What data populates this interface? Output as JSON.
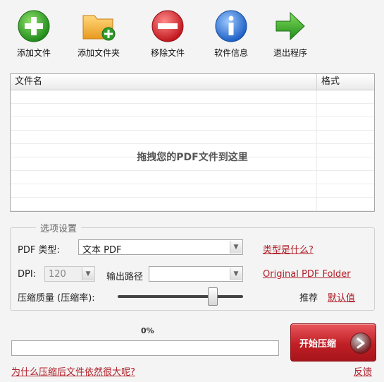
{
  "toolbar": {
    "add_file": "添加文件",
    "add_folder": "添加文件夹",
    "remove_file": "移除文件",
    "about": "软件信息",
    "exit": "退出程序"
  },
  "file_list": {
    "col_name": "文件名",
    "col_format": "格式",
    "drop_hint": "拖拽您的PDF文件到这里"
  },
  "options": {
    "title": "选项设置",
    "pdf_type_label": "PDF 类型:",
    "pdf_type_value": "文本 PDF",
    "what_type_link": "类型是什么?",
    "dpi_label": "DPI:",
    "dpi_value": "120",
    "output_path_label": "输出路径",
    "output_path_value": "",
    "output_folder_link": "Original PDF Folder",
    "quality_label": "压缩质量 (压缩率):",
    "quality_level": 0.75,
    "recommend_label": "推荐",
    "default_link": "默认值"
  },
  "progress": {
    "percent_text": "0%",
    "value": 0
  },
  "start_button": "开始压缩",
  "footer": {
    "why_big_link": "为什么压缩后文件依然很大呢?",
    "feedback_link": "反馈"
  },
  "colors": {
    "accent_red": "#c01f25",
    "link_red": "#b0202a"
  }
}
